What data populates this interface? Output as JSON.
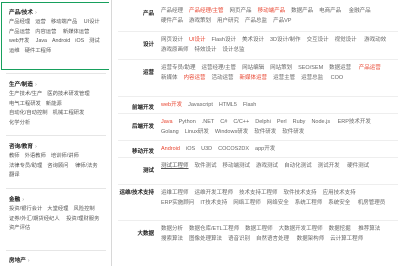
{
  "sidebar": {
    "categories": [
      {
        "title": "产品/技术",
        "links": [
          "产品经理",
          "运营",
          "移动端产品",
          "UI设计",
          "产品运营",
          "内容运营",
          "新媒体运营",
          "web开发",
          "Java",
          "Android",
          "iOS",
          "测试",
          "运维",
          "硬件工程师"
        ]
      },
      {
        "title": "生产/制造",
        "links": [
          "生产技术/生产",
          "医药技术研发管理",
          "电气工程研发",
          "新能源",
          "自动化/自动控制",
          "机械工程研发",
          "化学分析"
        ]
      },
      {
        "title": "咨询/教育",
        "links": [
          "教师",
          "外语教师",
          "培训师/讲师",
          "法律专员/助理",
          "咨询顾问",
          "律师/法务",
          "翻译"
        ]
      },
      {
        "title": "金融",
        "links": [
          "投资/银行会计",
          "大堂经理",
          "风险控制",
          "证券/外汇/期货经纪人",
          "投资/理财服务",
          "资产评估"
        ]
      },
      {
        "title": "房地产",
        "links": []
      }
    ]
  },
  "main": {
    "rows": [
      {
        "label": "产品",
        "links": [
          "产品经理",
          "产品经理/主管",
          "网页产品",
          "移动端产品",
          "数据产品",
          "电商产品",
          "金融产品",
          "硬件产品",
          "游戏策划",
          "用户研究",
          "产品总监",
          "产品VP"
        ],
        "red": [
          1,
          3
        ]
      },
      {
        "label": "设计",
        "links": [
          "网页设计",
          "UI设计",
          "Flash设计",
          "美术设计",
          "3D设计/制作",
          "交互设计",
          "视觉设计",
          "游戏动效",
          "游戏原画师",
          "特效设计",
          "设计总监"
        ],
        "red": [
          1
        ]
      },
      {
        "label": "运营",
        "links": [
          "运营专员/助理",
          "运营经理/主管",
          "网站编辑",
          "网站策划",
          "SEO/SEM",
          "数据运营",
          "产品运营",
          "新媒体",
          "内容运营",
          "活动运营",
          "新媒体运营",
          "运营主管",
          "运营总监",
          "COO"
        ],
        "red": [
          6,
          8,
          10
        ]
      },
      {
        "label": "前端开发",
        "links": [
          "web开发",
          "Javascript",
          "HTML5",
          "Flash"
        ],
        "red": [
          0
        ]
      },
      {
        "label": "后端开发",
        "links": [
          "Java",
          "Python",
          ".NET",
          "C#",
          "C/C++",
          "Delphi",
          "Perl",
          "Ruby",
          "Node.js",
          "ERP技术开发",
          "Golang",
          "Linux研发",
          "Windows研发",
          "软件研发",
          "软件研发"
        ],
        "red": [
          0
        ]
      },
      {
        "label": "移动开发",
        "links": [
          "Android",
          "iOS",
          "U3D",
          "COCOS2DX",
          "app开发"
        ],
        "red": [
          0
        ]
      },
      {
        "label": "测试",
        "links": [
          "测试工程师",
          "软件测试",
          "移动端测试",
          "游戏测试",
          "自动化测试",
          "测试开发",
          "硬件测试"
        ],
        "red": []
      },
      {
        "label": "运维/技术支持",
        "links": [
          "运维工程师",
          "运维开发工程师",
          "技术支持工程师",
          "软件技术支持",
          "应用技术支持",
          "ERP实施顾问",
          "IT技术支持",
          "网络工程师",
          "网络安全",
          "系统工程师",
          "系统安全",
          "机房管理员"
        ],
        "red": []
      },
      {
        "label": "大数据",
        "links": [
          "数据分析",
          "数据仓库/ETL工程师",
          "数据工程师",
          "大数据开发工程师",
          "数据挖掘",
          "推荐算法",
          "搜索算法",
          "图像处理算法",
          "语音识别",
          "自然语言处理",
          "数据架构师",
          "云计算工程师"
        ],
        "red": []
      }
    ]
  }
}
